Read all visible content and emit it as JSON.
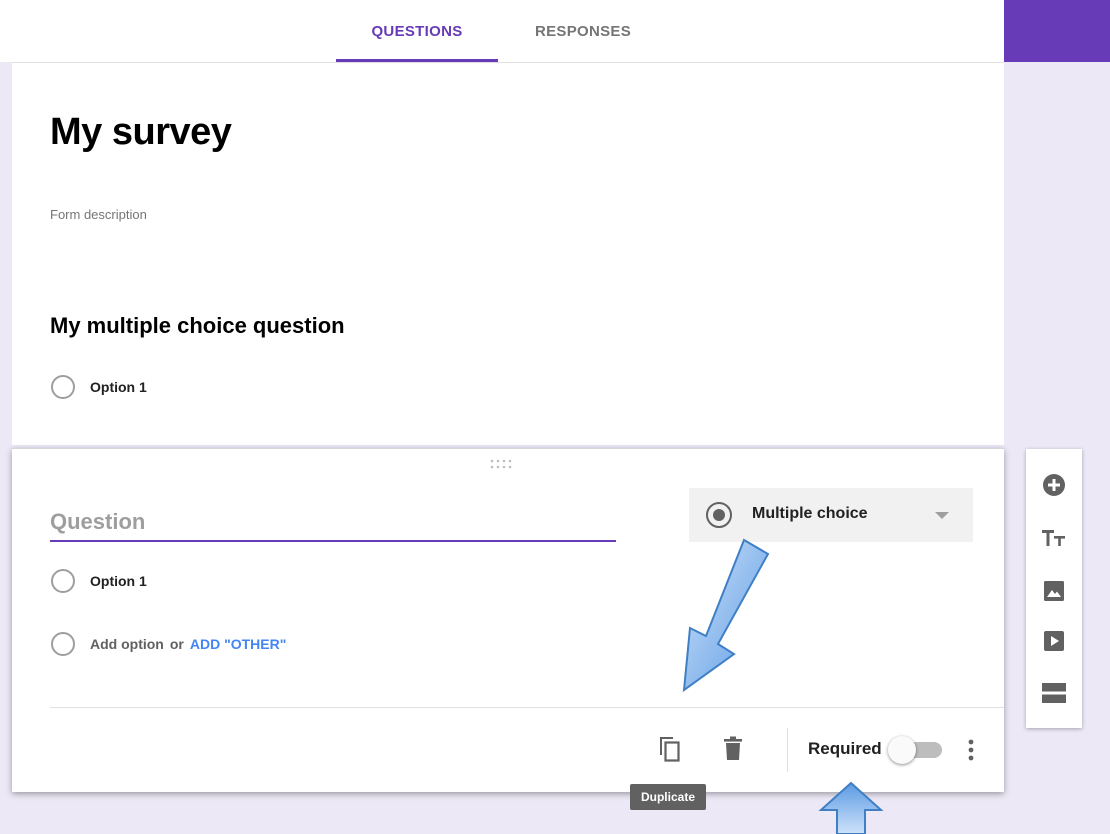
{
  "tabs": [
    {
      "label": "QUESTIONS",
      "active": true
    },
    {
      "label": "RESPONSES",
      "active": false
    }
  ],
  "form": {
    "title": "My survey",
    "description_placeholder": "Form description"
  },
  "question_1": {
    "title": "My multiple choice question",
    "options": [
      "Option 1"
    ]
  },
  "active_question": {
    "placeholder": "Question",
    "type_label": "Multiple choice",
    "options": [
      "Option 1"
    ],
    "add_option": "Add option",
    "or": "or",
    "add_other": "ADD \"OTHER\"",
    "required_label": "Required",
    "required": false
  },
  "tooltip": {
    "duplicate": "Duplicate"
  },
  "icons": {
    "duplicate": "duplicate-icon",
    "delete": "trash-icon",
    "more": "more-vert-icon",
    "add_question": "add-circle-icon",
    "add_title": "title-icon",
    "add_image": "image-icon",
    "add_video": "video-icon",
    "add_section": "section-icon"
  },
  "colors": {
    "accent": "#673ab7",
    "background": "#ece8f6",
    "link": "#4285f4",
    "annotation_arrow": "#6fa8e8"
  }
}
